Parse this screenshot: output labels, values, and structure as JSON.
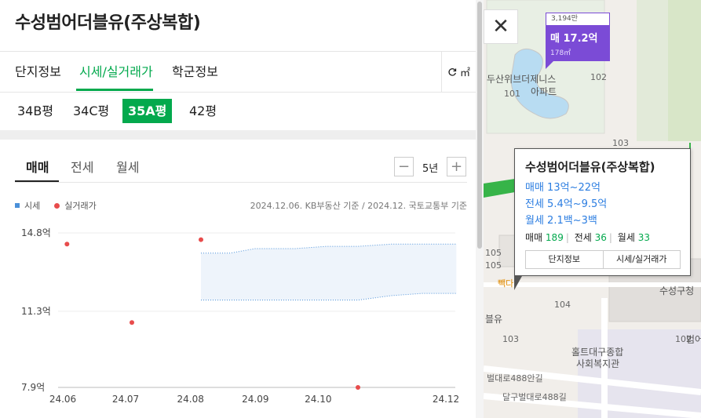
{
  "panel": {
    "title": "수성범어더블유(주상복합)",
    "tabs": [
      "단지정보",
      "시세/실거래가",
      "학군정보"
    ],
    "unit_label": "㎡",
    "pyeong_types": [
      "34B평",
      "34C평",
      "35A평",
      "42평"
    ],
    "active_pyeong": "35A평",
    "trade_tabs": [
      "매매",
      "전세",
      "월세"
    ],
    "period": "5년",
    "minus": "−",
    "plus": "+",
    "legend": {
      "market": "시세",
      "actual": "실거래가"
    },
    "source": "2024.12.06. KB부동산 기준 / 2024.12. 국토교통부 기준"
  },
  "chart_data": {
    "type": "scatter",
    "x_ticks": [
      "24.06",
      "24.07",
      "24.08",
      "24.09",
      "24.10",
      "24.12"
    ],
    "y_ticks": [
      "14.8억",
      "11.3억",
      "7.9억"
    ],
    "ylim": [
      7.9,
      14.8
    ],
    "series": [
      {
        "name": "실거래가",
        "points": [
          {
            "x": "2024-06-03",
            "y": 14.3
          },
          {
            "x": "2024-07-04",
            "y": 10.8
          },
          {
            "x": "2024-08-06",
            "y": 14.5
          },
          {
            "x": "2024-10-20",
            "y": 7.9
          }
        ],
        "color": "#e84c4c"
      },
      {
        "name": "시세",
        "color": "#4a90d9",
        "band": {
          "x": [
            "2024-08-06",
            "2024-08-20",
            "2024-09-01",
            "2024-09-20",
            "2024-10-05",
            "2024-10-20",
            "2024-11-05",
            "2024-11-20",
            "2024-12-06"
          ],
          "upper": [
            13.9,
            13.9,
            14.1,
            14.1,
            14.2,
            14.2,
            14.3,
            14.3,
            14.3
          ],
          "lower": [
            11.8,
            11.8,
            11.8,
            11.8,
            11.8,
            11.8,
            12.0,
            12.1,
            12.1
          ]
        }
      }
    ]
  },
  "map": {
    "close": "✕",
    "price_marker": {
      "top": "3,194만",
      "price": "매 17.2억",
      "area": "178㎡"
    },
    "info_card": {
      "title": "수성범어더블유(주상복합)",
      "sale": "매매 13억~22억",
      "jeonse": "전세 5.4억~9.5억",
      "monthly": "월세 2.1백~3백",
      "counts": {
        "sale_label": "매매",
        "sale": "189",
        "jeonse_label": "전세",
        "jeonse": "36",
        "monthly_label": "월세",
        "monthly": "33"
      },
      "btn_info": "단지정보",
      "btn_price": "시세/실거래가"
    },
    "labels": [
      "두산위브더제니스",
      "아파트",
      "102",
      "103",
      "105",
      "105",
      "104",
      "103",
      "102",
      "101",
      "수성구청",
      "범어",
      "홀트대구종합",
      "사회복지관",
      "벌대로488안길",
      "달구벌대로488길",
      "블유",
      "빽다"
    ]
  }
}
